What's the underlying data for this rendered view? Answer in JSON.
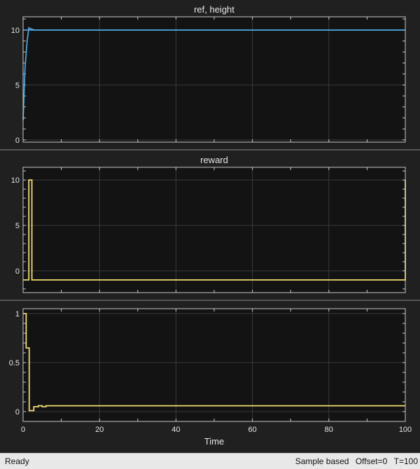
{
  "colors": {
    "figure_bg": "#202020",
    "axes_bg": "#131313",
    "axes_edge": "#c8c8c8",
    "grid": "#3a3a3a",
    "text": "#e6e6e6",
    "reference_line": "#4da3d9",
    "signal_line": "#f0dc6e"
  },
  "status": {
    "ready": "Ready",
    "mode": "Sample based",
    "offset": "Offset=0",
    "time": "T=100"
  },
  "chart_data": [
    {
      "type": "line",
      "title": "ref, height",
      "xlim": [
        0,
        100
      ],
      "ylim": [
        -0.2,
        11.2
      ],
      "yticks": [
        0,
        5,
        10
      ],
      "ytick_labels": [
        "0",
        "5",
        "10"
      ],
      "show_xticklabels": false,
      "grid": true,
      "series": [
        {
          "color": "#4da3d9",
          "x": [
            0,
            100
          ],
          "y": [
            10,
            10
          ]
        },
        {
          "color": "#4da3d9",
          "x": [
            0,
            0.5,
            1,
            1.5,
            2,
            3,
            4,
            100
          ],
          "y": [
            1.8,
            6.5,
            8.8,
            10.2,
            10.1,
            10.0,
            10.0,
            10.0
          ]
        }
      ]
    },
    {
      "type": "line",
      "title": "reward",
      "xlim": [
        0,
        100
      ],
      "ylim": [
        -2.4,
        11.4
      ],
      "yticks": [
        0,
        5,
        10
      ],
      "ytick_labels": [
        "0",
        "5",
        "10"
      ],
      "show_xticklabels": false,
      "grid": true,
      "step": true,
      "series": [
        {
          "color": "#f0dc6e",
          "x": [
            0,
            1.5,
            1.5,
            2.3,
            2.3,
            100
          ],
          "y": [
            -1,
            -1,
            10,
            10,
            -1,
            10
          ]
        }
      ]
    },
    {
      "type": "line",
      "title": "",
      "xlim": [
        0,
        100
      ],
      "ylim": [
        -0.1,
        1.05
      ],
      "yticks": [
        0,
        0.5,
        1
      ],
      "ytick_labels": [
        "0",
        "0.5",
        "1"
      ],
      "xticks": [
        0,
        20,
        40,
        60,
        80,
        100
      ],
      "xtick_labels": [
        "0",
        "20",
        "40",
        "60",
        "80",
        "100"
      ],
      "xlabel": "Time",
      "show_xticklabels": true,
      "grid": true,
      "step": true,
      "series": [
        {
          "color": "#f0dc6e",
          "x": [
            0,
            0.8,
            1.6,
            2.8,
            3.0,
            4.0,
            5.0,
            5.5,
            6.0,
            100
          ],
          "y": [
            1.0,
            0.65,
            0.01,
            0.05,
            0.05,
            0.06,
            0.05,
            0.05,
            0.06,
            0.06
          ]
        }
      ]
    }
  ]
}
